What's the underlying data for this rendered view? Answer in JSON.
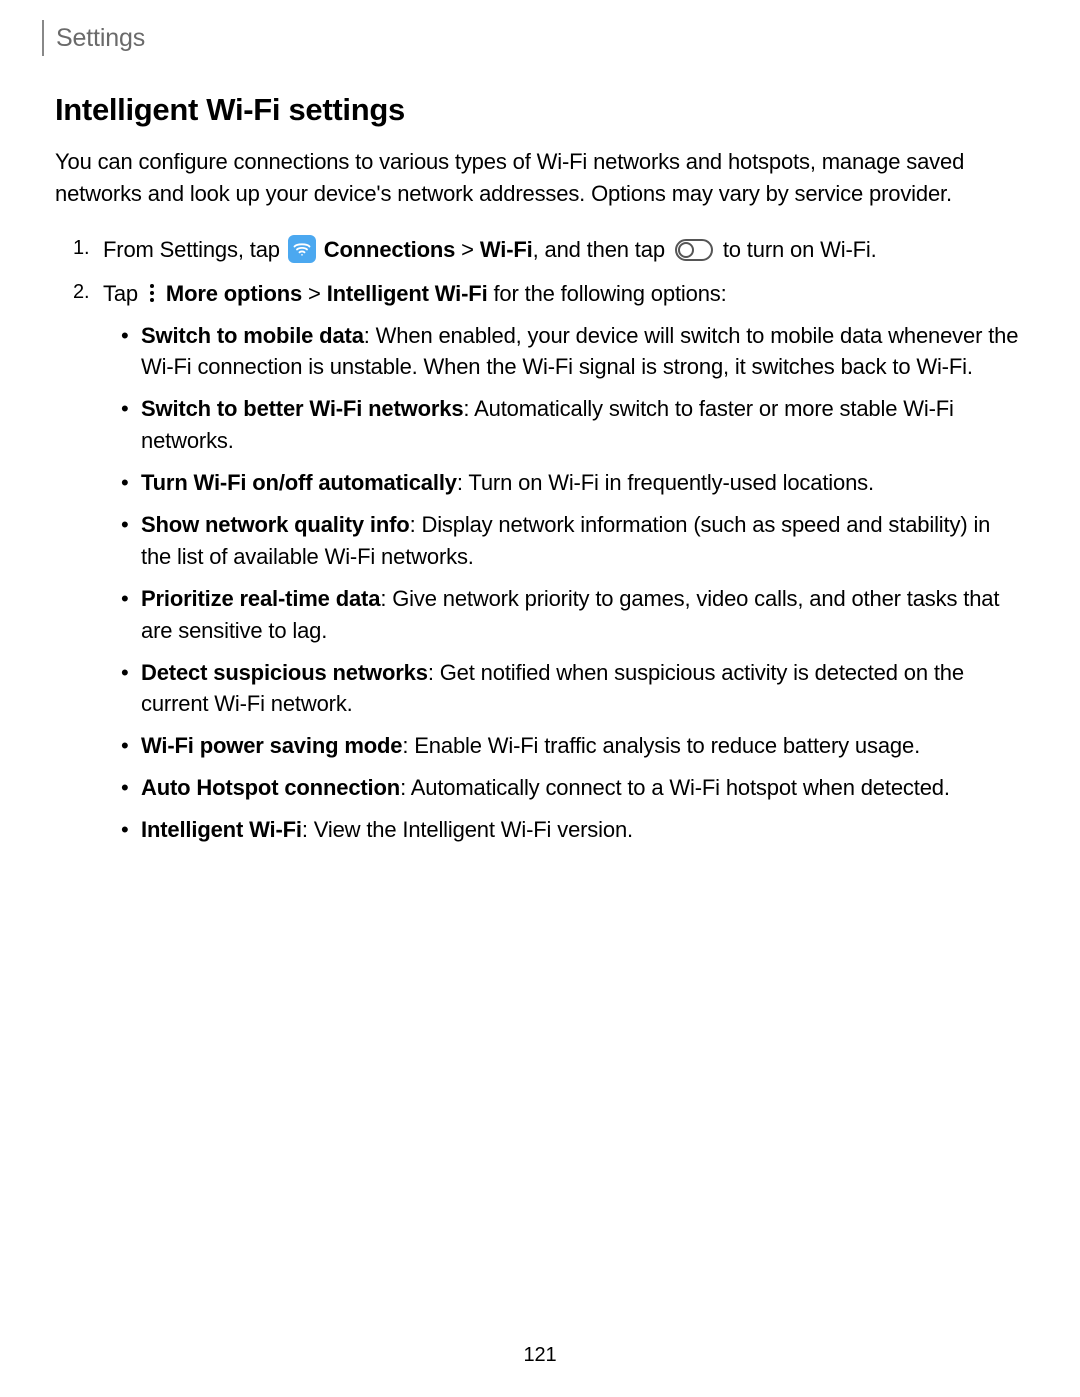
{
  "header": "Settings",
  "heading": "Intelligent Wi-Fi settings",
  "intro": "You can configure connections to various types of Wi-Fi networks and hotspots, manage saved networks and look up your device's network addresses. Options may vary by service provider.",
  "step1": {
    "a": "From Settings, tap ",
    "connections": "Connections",
    "gt": " > ",
    "wifi": "Wi-Fi",
    "b": ", and then tap ",
    "c": " to turn on Wi-Fi."
  },
  "step2": {
    "a": "Tap ",
    "more": "More options",
    "gt": " > ",
    "iwifi": "Intelligent Wi-Fi",
    "b": " for the following options:"
  },
  "bullets": [
    {
      "t": "Switch to mobile data",
      "d": ": When enabled, your device will switch to mobile data whenever the Wi-Fi connection is unstable. When the Wi-Fi signal is strong, it switches back to Wi-Fi."
    },
    {
      "t": "Switch to better Wi-Fi networks",
      "d": ": Automatically switch to faster or more stable Wi-Fi networks."
    },
    {
      "t": "Turn Wi-Fi on/off automatically",
      "d": ": Turn on Wi-Fi in frequently-used locations."
    },
    {
      "t": "Show network quality info",
      "d": ": Display network information (such as speed and stability) in the list of available Wi-Fi networks."
    },
    {
      "t": "Prioritize real-time data",
      "d": ": Give network priority to games, video calls, and other tasks that are sensitive to lag."
    },
    {
      "t": "Detect suspicious networks",
      "d": ": Get notified when suspicious activity is detected on the current Wi-Fi network."
    },
    {
      "t": "Wi-Fi power saving mode",
      "d": ": Enable Wi-Fi traffic analysis to reduce battery usage."
    },
    {
      "t": "Auto Hotspot connection",
      "d": ": Automatically connect to a Wi-Fi hotspot when detected."
    },
    {
      "t": "Intelligent Wi-Fi",
      "d": ": View the Intelligent Wi-Fi version."
    }
  ],
  "pageNumber": "121"
}
